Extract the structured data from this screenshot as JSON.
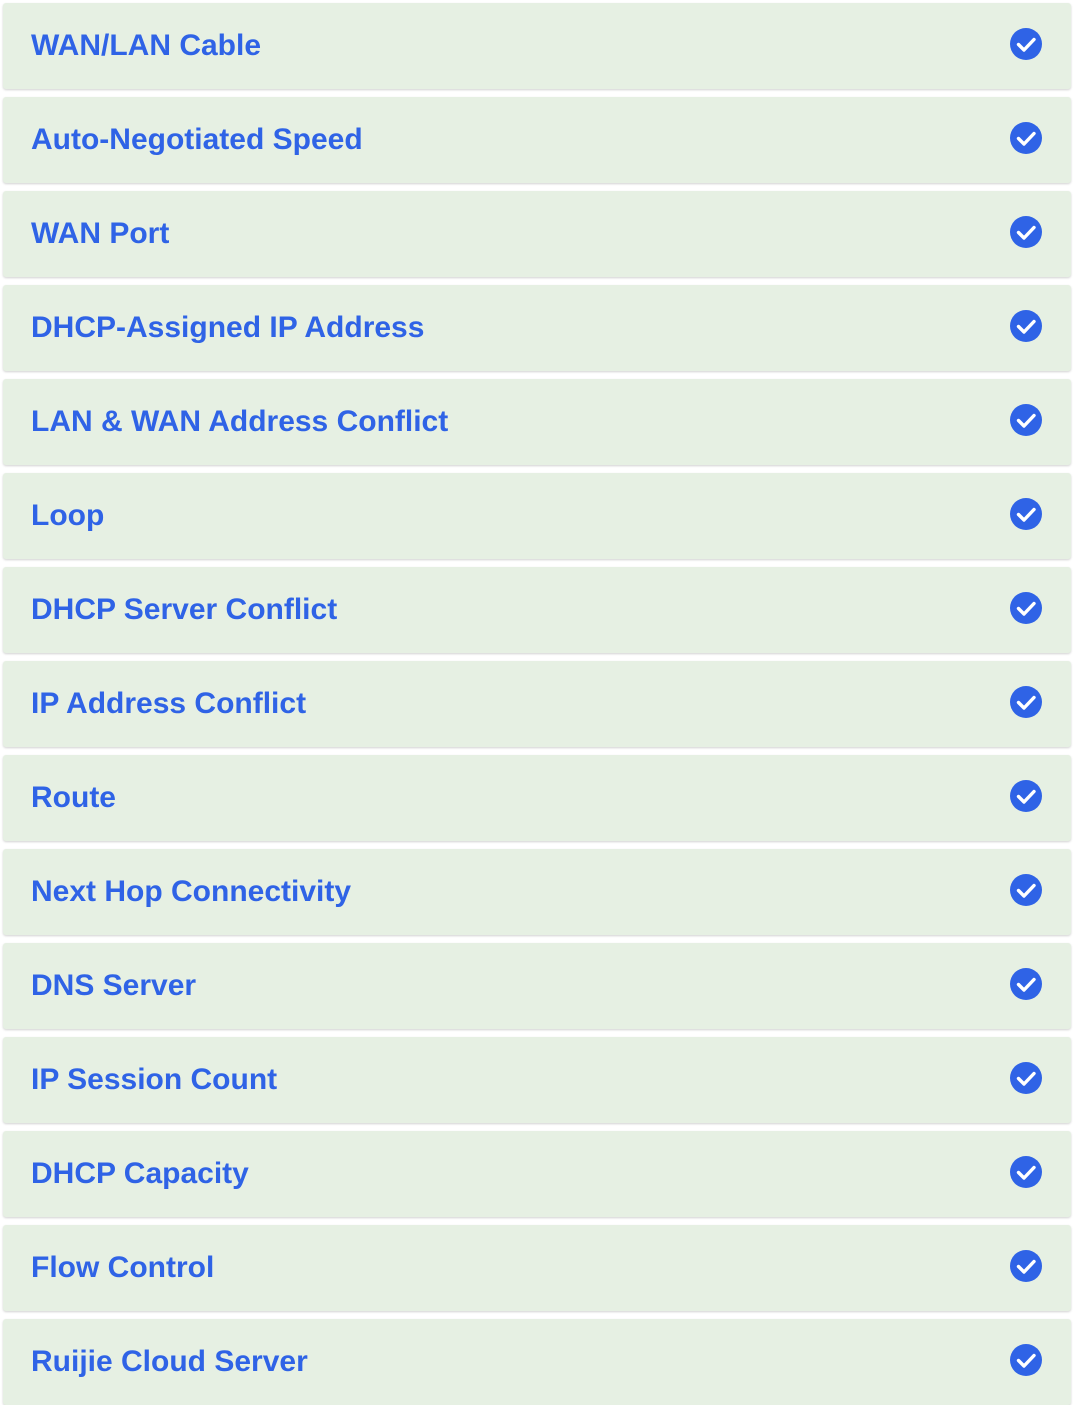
{
  "colors": {
    "accent": "#2f63e6",
    "row_background": "#e6f0e3",
    "page_background": "#ffffff"
  },
  "checks": [
    {
      "label": "WAN/LAN Cable",
      "status": "passed",
      "icon": "check-circle-icon"
    },
    {
      "label": "Auto-Negotiated Speed",
      "status": "passed",
      "icon": "check-circle-icon"
    },
    {
      "label": "WAN Port",
      "status": "passed",
      "icon": "check-circle-icon"
    },
    {
      "label": "DHCP-Assigned IP Address",
      "status": "passed",
      "icon": "check-circle-icon"
    },
    {
      "label": "LAN & WAN Address Conflict",
      "status": "passed",
      "icon": "check-circle-icon"
    },
    {
      "label": "Loop",
      "status": "passed",
      "icon": "check-circle-icon"
    },
    {
      "label": "DHCP Server Conflict",
      "status": "passed",
      "icon": "check-circle-icon"
    },
    {
      "label": "IP Address Conflict",
      "status": "passed",
      "icon": "check-circle-icon"
    },
    {
      "label": "Route",
      "status": "passed",
      "icon": "check-circle-icon"
    },
    {
      "label": "Next Hop Connectivity",
      "status": "passed",
      "icon": "check-circle-icon"
    },
    {
      "label": "DNS Server",
      "status": "passed",
      "icon": "check-circle-icon"
    },
    {
      "label": "IP Session Count",
      "status": "passed",
      "icon": "check-circle-icon"
    },
    {
      "label": "DHCP Capacity",
      "status": "passed",
      "icon": "check-circle-icon"
    },
    {
      "label": "Flow Control",
      "status": "passed",
      "icon": "check-circle-icon"
    },
    {
      "label": "Ruijie Cloud Server",
      "status": "passed",
      "icon": "check-circle-icon"
    }
  ]
}
